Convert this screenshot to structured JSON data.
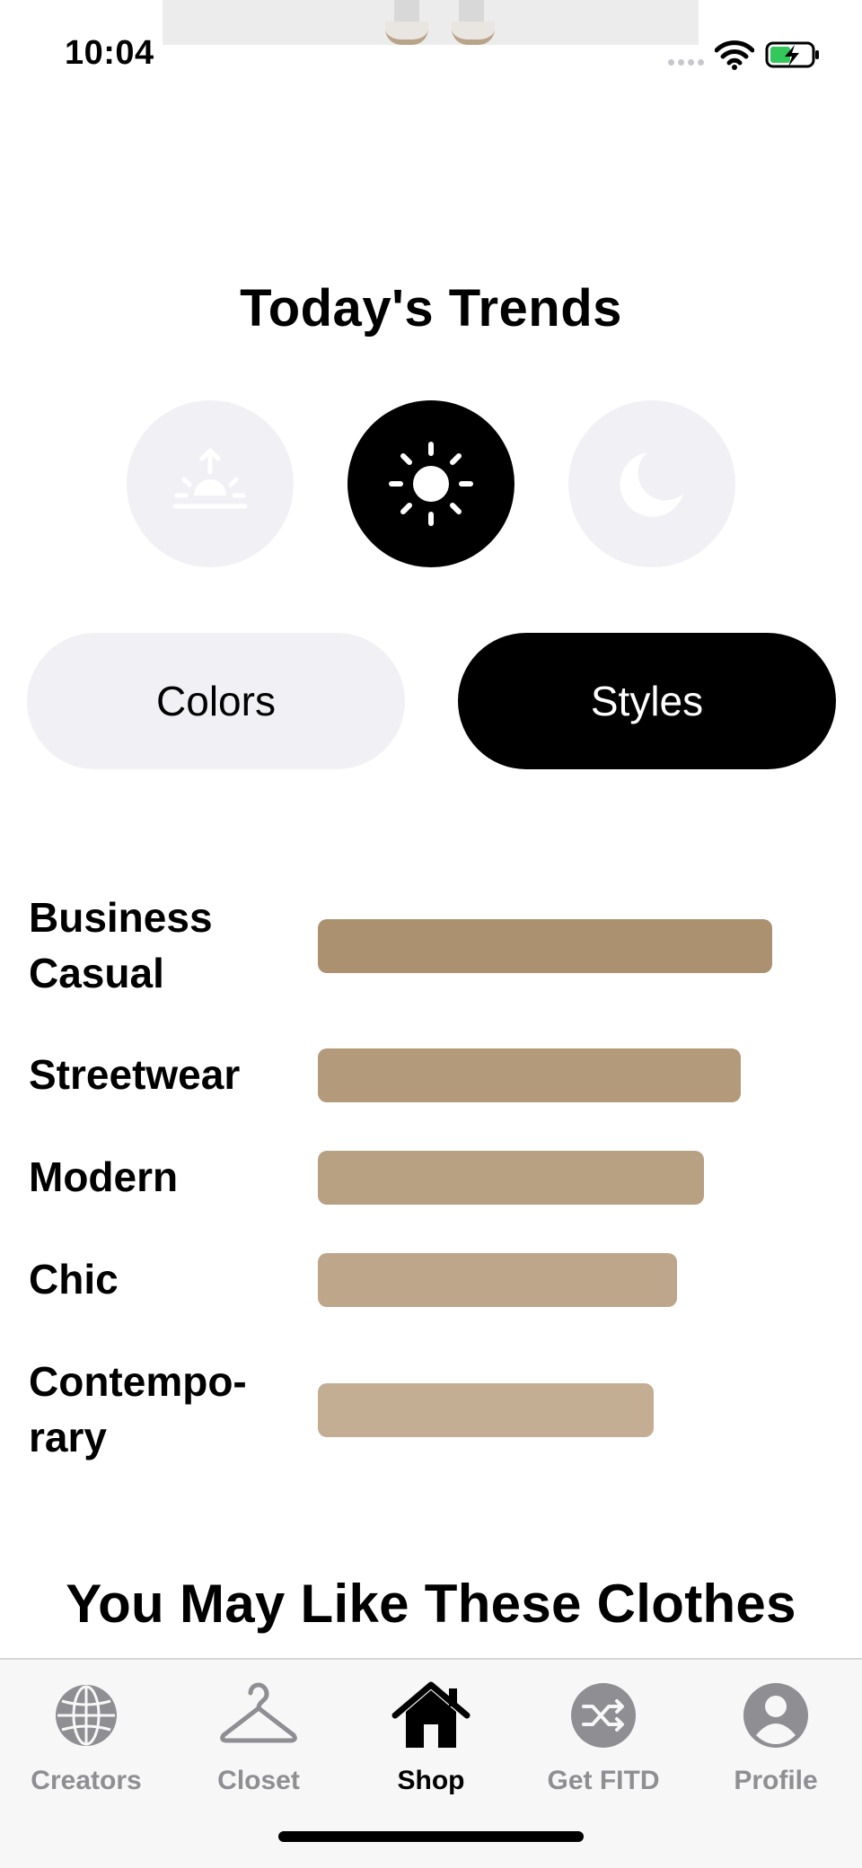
{
  "status_bar": {
    "time": "10:04"
  },
  "header": {
    "title": "Today's Trends"
  },
  "time_of_day": [
    {
      "icon": "sunrise-icon",
      "active": false
    },
    {
      "icon": "sun-icon",
      "active": true
    },
    {
      "icon": "moon-icon",
      "active": false
    }
  ],
  "segment": {
    "colors_label": "Colors",
    "styles_label": "Styles",
    "selected": "Styles"
  },
  "trends": [
    {
      "label": "Business Casual",
      "level": 1.0,
      "color": "#ab916f"
    },
    {
      "label": "Streetwear",
      "level": 0.93,
      "color": "#b39a7a"
    },
    {
      "label": "Modern",
      "level": 0.85,
      "color": "#b8a083"
    },
    {
      "label": "Chic",
      "level": 0.79,
      "color": "#bea68a"
    },
    {
      "label": "Contempo-rary",
      "level": 0.74,
      "color": "#c3ad93"
    }
  ],
  "section": {
    "title": "You May Like These Clothes"
  },
  "tabbar": {
    "items": [
      {
        "label": "Creators",
        "icon": "globe-icon",
        "active": false
      },
      {
        "label": "Closet",
        "icon": "hanger-icon",
        "active": false
      },
      {
        "label": "Shop",
        "icon": "house-icon",
        "active": true
      },
      {
        "label": "Get FITD",
        "icon": "shuffle-icon",
        "active": false
      },
      {
        "label": "Profile",
        "icon": "person-icon",
        "active": false
      }
    ]
  },
  "colors": {
    "active": "#000000",
    "inactive_fill": "#f1f1f5",
    "inactive_icon": "#ffffff",
    "tab_inactive": "#8e8e93"
  }
}
